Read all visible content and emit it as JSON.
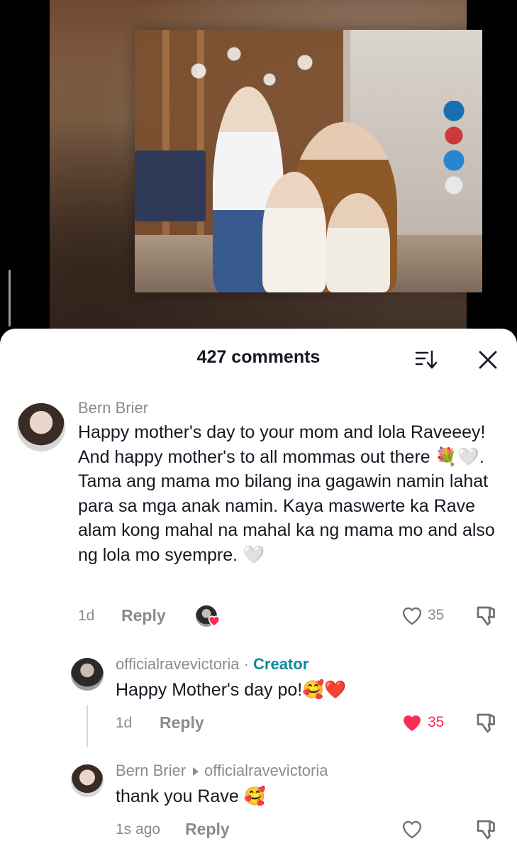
{
  "header": {
    "title": "427 comments"
  },
  "comments": [
    {
      "username": "Bern Brier",
      "text": "Happy mother's day to your mom and lola Raveeey! And happy mother's to all mommas out there 💐🤍. Tama ang mama mo bilang ina gagawin namin lahat para sa mga anak namin. Kaya maswerte ka Rave alam kong mahal na mahal ka ng mama mo and also ng lola mo syempre. 🤍",
      "time": "1d",
      "reply_label": "Reply",
      "likes": "35",
      "liked": false,
      "creator_liked": true
    },
    {
      "username": "officialravevictoria",
      "separator": " · ",
      "badge": "Creator",
      "text": "Happy Mother's day po!🥰❤️",
      "time": "1d",
      "reply_label": "Reply",
      "likes": "35",
      "liked": true
    },
    {
      "username": "Bern Brier",
      "reply_to": "officialravevictoria",
      "text": "thank you Rave 🥰",
      "time": "1s ago",
      "reply_label": "Reply",
      "likes": "",
      "liked": false
    }
  ],
  "colors": {
    "accent_like": "#fe2c55",
    "creator_badge": "#0e8b9a",
    "meta_gray": "#8a8b91"
  },
  "icons": [
    "sort-icon",
    "close-icon",
    "heart-icon",
    "dislike-icon"
  ]
}
